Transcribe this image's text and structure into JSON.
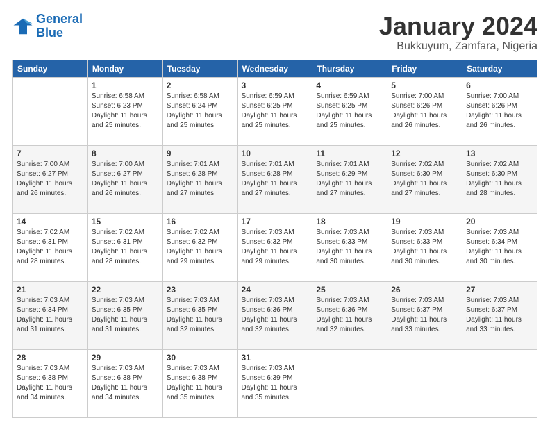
{
  "logo": {
    "line1": "General",
    "line2": "Blue"
  },
  "title": "January 2024",
  "subtitle": "Bukkuyum, Zamfara, Nigeria",
  "days_header": [
    "Sunday",
    "Monday",
    "Tuesday",
    "Wednesday",
    "Thursday",
    "Friday",
    "Saturday"
  ],
  "weeks": [
    [
      {
        "num": "",
        "sunrise": "",
        "sunset": "",
        "daylight": ""
      },
      {
        "num": "1",
        "sunrise": "Sunrise: 6:58 AM",
        "sunset": "Sunset: 6:23 PM",
        "daylight": "Daylight: 11 hours and 25 minutes."
      },
      {
        "num": "2",
        "sunrise": "Sunrise: 6:58 AM",
        "sunset": "Sunset: 6:24 PM",
        "daylight": "Daylight: 11 hours and 25 minutes."
      },
      {
        "num": "3",
        "sunrise": "Sunrise: 6:59 AM",
        "sunset": "Sunset: 6:25 PM",
        "daylight": "Daylight: 11 hours and 25 minutes."
      },
      {
        "num": "4",
        "sunrise": "Sunrise: 6:59 AM",
        "sunset": "Sunset: 6:25 PM",
        "daylight": "Daylight: 11 hours and 25 minutes."
      },
      {
        "num": "5",
        "sunrise": "Sunrise: 7:00 AM",
        "sunset": "Sunset: 6:26 PM",
        "daylight": "Daylight: 11 hours and 26 minutes."
      },
      {
        "num": "6",
        "sunrise": "Sunrise: 7:00 AM",
        "sunset": "Sunset: 6:26 PM",
        "daylight": "Daylight: 11 hours and 26 minutes."
      }
    ],
    [
      {
        "num": "7",
        "sunrise": "Sunrise: 7:00 AM",
        "sunset": "Sunset: 6:27 PM",
        "daylight": "Daylight: 11 hours and 26 minutes."
      },
      {
        "num": "8",
        "sunrise": "Sunrise: 7:00 AM",
        "sunset": "Sunset: 6:27 PM",
        "daylight": "Daylight: 11 hours and 26 minutes."
      },
      {
        "num": "9",
        "sunrise": "Sunrise: 7:01 AM",
        "sunset": "Sunset: 6:28 PM",
        "daylight": "Daylight: 11 hours and 27 minutes."
      },
      {
        "num": "10",
        "sunrise": "Sunrise: 7:01 AM",
        "sunset": "Sunset: 6:28 PM",
        "daylight": "Daylight: 11 hours and 27 minutes."
      },
      {
        "num": "11",
        "sunrise": "Sunrise: 7:01 AM",
        "sunset": "Sunset: 6:29 PM",
        "daylight": "Daylight: 11 hours and 27 minutes."
      },
      {
        "num": "12",
        "sunrise": "Sunrise: 7:02 AM",
        "sunset": "Sunset: 6:30 PM",
        "daylight": "Daylight: 11 hours and 27 minutes."
      },
      {
        "num": "13",
        "sunrise": "Sunrise: 7:02 AM",
        "sunset": "Sunset: 6:30 PM",
        "daylight": "Daylight: 11 hours and 28 minutes."
      }
    ],
    [
      {
        "num": "14",
        "sunrise": "Sunrise: 7:02 AM",
        "sunset": "Sunset: 6:31 PM",
        "daylight": "Daylight: 11 hours and 28 minutes."
      },
      {
        "num": "15",
        "sunrise": "Sunrise: 7:02 AM",
        "sunset": "Sunset: 6:31 PM",
        "daylight": "Daylight: 11 hours and 28 minutes."
      },
      {
        "num": "16",
        "sunrise": "Sunrise: 7:02 AM",
        "sunset": "Sunset: 6:32 PM",
        "daylight": "Daylight: 11 hours and 29 minutes."
      },
      {
        "num": "17",
        "sunrise": "Sunrise: 7:03 AM",
        "sunset": "Sunset: 6:32 PM",
        "daylight": "Daylight: 11 hours and 29 minutes."
      },
      {
        "num": "18",
        "sunrise": "Sunrise: 7:03 AM",
        "sunset": "Sunset: 6:33 PM",
        "daylight": "Daylight: 11 hours and 30 minutes."
      },
      {
        "num": "19",
        "sunrise": "Sunrise: 7:03 AM",
        "sunset": "Sunset: 6:33 PM",
        "daylight": "Daylight: 11 hours and 30 minutes."
      },
      {
        "num": "20",
        "sunrise": "Sunrise: 7:03 AM",
        "sunset": "Sunset: 6:34 PM",
        "daylight": "Daylight: 11 hours and 30 minutes."
      }
    ],
    [
      {
        "num": "21",
        "sunrise": "Sunrise: 7:03 AM",
        "sunset": "Sunset: 6:34 PM",
        "daylight": "Daylight: 11 hours and 31 minutes."
      },
      {
        "num": "22",
        "sunrise": "Sunrise: 7:03 AM",
        "sunset": "Sunset: 6:35 PM",
        "daylight": "Daylight: 11 hours and 31 minutes."
      },
      {
        "num": "23",
        "sunrise": "Sunrise: 7:03 AM",
        "sunset": "Sunset: 6:35 PM",
        "daylight": "Daylight: 11 hours and 32 minutes."
      },
      {
        "num": "24",
        "sunrise": "Sunrise: 7:03 AM",
        "sunset": "Sunset: 6:36 PM",
        "daylight": "Daylight: 11 hours and 32 minutes."
      },
      {
        "num": "25",
        "sunrise": "Sunrise: 7:03 AM",
        "sunset": "Sunset: 6:36 PM",
        "daylight": "Daylight: 11 hours and 32 minutes."
      },
      {
        "num": "26",
        "sunrise": "Sunrise: 7:03 AM",
        "sunset": "Sunset: 6:37 PM",
        "daylight": "Daylight: 11 hours and 33 minutes."
      },
      {
        "num": "27",
        "sunrise": "Sunrise: 7:03 AM",
        "sunset": "Sunset: 6:37 PM",
        "daylight": "Daylight: 11 hours and 33 minutes."
      }
    ],
    [
      {
        "num": "28",
        "sunrise": "Sunrise: 7:03 AM",
        "sunset": "Sunset: 6:38 PM",
        "daylight": "Daylight: 11 hours and 34 minutes."
      },
      {
        "num": "29",
        "sunrise": "Sunrise: 7:03 AM",
        "sunset": "Sunset: 6:38 PM",
        "daylight": "Daylight: 11 hours and 34 minutes."
      },
      {
        "num": "30",
        "sunrise": "Sunrise: 7:03 AM",
        "sunset": "Sunset: 6:38 PM",
        "daylight": "Daylight: 11 hours and 35 minutes."
      },
      {
        "num": "31",
        "sunrise": "Sunrise: 7:03 AM",
        "sunset": "Sunset: 6:39 PM",
        "daylight": "Daylight: 11 hours and 35 minutes."
      },
      {
        "num": "",
        "sunrise": "",
        "sunset": "",
        "daylight": ""
      },
      {
        "num": "",
        "sunrise": "",
        "sunset": "",
        "daylight": ""
      },
      {
        "num": "",
        "sunrise": "",
        "sunset": "",
        "daylight": ""
      }
    ]
  ]
}
